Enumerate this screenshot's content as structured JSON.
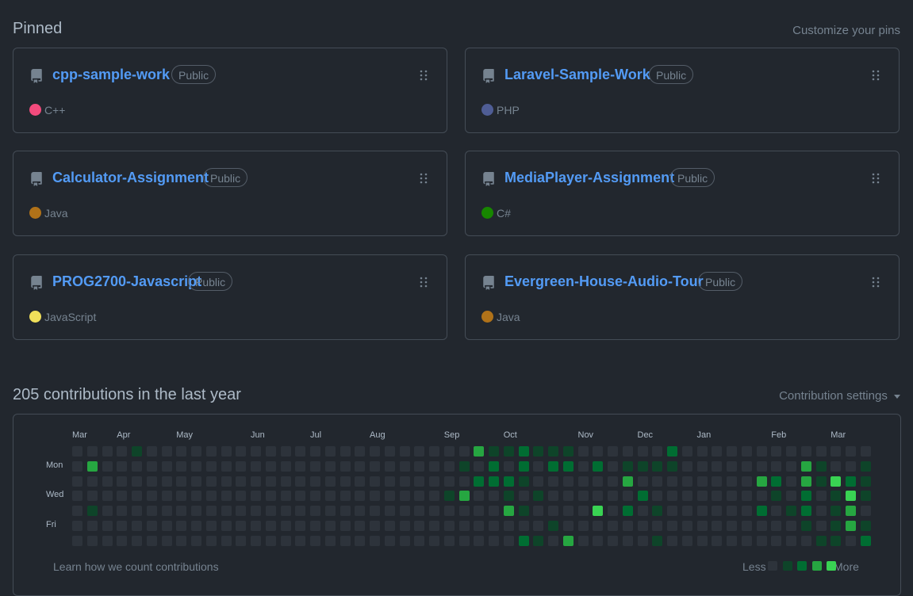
{
  "pinned": {
    "title": "Pinned",
    "customize_label": "Customize your pins",
    "repos": [
      {
        "name": "cpp-sample-work",
        "visibility": "Public",
        "language": "C++",
        "lang_color": "#f34b7d"
      },
      {
        "name": "Laravel-Sample-Work",
        "visibility": "Public",
        "language": "PHP",
        "lang_color": "#4f5d95"
      },
      {
        "name": "Calculator-Assignment",
        "visibility": "Public",
        "language": "Java",
        "lang_color": "#b07219"
      },
      {
        "name": "MediaPlayer-Assignment",
        "visibility": "Public",
        "language": "C#",
        "lang_color": "#178600"
      },
      {
        "name": "PROG2700-Javascript",
        "visibility": "Public",
        "language": "JavaScript",
        "lang_color": "#f1e05a"
      },
      {
        "name": "Evergreen-House-Audio-Tour",
        "visibility": "Public",
        "language": "Java",
        "lang_color": "#b07219"
      }
    ]
  },
  "contributions": {
    "title": "205 contributions in the last year",
    "settings_label": "Contribution settings",
    "months": [
      {
        "label": "Mar",
        "week": 0
      },
      {
        "label": "Apr",
        "week": 3
      },
      {
        "label": "May",
        "week": 7
      },
      {
        "label": "Jun",
        "week": 12
      },
      {
        "label": "Jul",
        "week": 16
      },
      {
        "label": "Aug",
        "week": 20
      },
      {
        "label": "Sep",
        "week": 25
      },
      {
        "label": "Oct",
        "week": 29
      },
      {
        "label": "Nov",
        "week": 34
      },
      {
        "label": "Dec",
        "week": 38
      },
      {
        "label": "Jan",
        "week": 42
      },
      {
        "label": "Feb",
        "week": 47
      },
      {
        "label": "Mar",
        "week": 51
      }
    ],
    "days": [
      {
        "label": "Mon",
        "row": 1
      },
      {
        "label": "Wed",
        "row": 3
      },
      {
        "label": "Fri",
        "row": 5
      }
    ],
    "level_colors": [
      "#2d333b",
      "#0e4429",
      "#006d32",
      "#26a641",
      "#39d353"
    ],
    "cells": [
      [
        0,
        0,
        0,
        0,
        0,
        0,
        0
      ],
      [
        0,
        3,
        0,
        0,
        1,
        0,
        0
      ],
      [
        0,
        0,
        0,
        0,
        0,
        0,
        0
      ],
      [
        0,
        0,
        0,
        0,
        0,
        0,
        0
      ],
      [
        1,
        0,
        0,
        0,
        0,
        0,
        0
      ],
      [
        0,
        0,
        0,
        0,
        0,
        0,
        0
      ],
      [
        0,
        0,
        0,
        0,
        0,
        0,
        0
      ],
      [
        0,
        0,
        0,
        0,
        0,
        0,
        0
      ],
      [
        0,
        0,
        0,
        0,
        0,
        0,
        0
      ],
      [
        0,
        0,
        0,
        0,
        0,
        0,
        0
      ],
      [
        0,
        0,
        0,
        0,
        0,
        0,
        0
      ],
      [
        0,
        0,
        0,
        0,
        0,
        0,
        0
      ],
      [
        0,
        0,
        0,
        0,
        0,
        0,
        0
      ],
      [
        0,
        0,
        0,
        0,
        0,
        0,
        0
      ],
      [
        0,
        0,
        0,
        0,
        0,
        0,
        0
      ],
      [
        0,
        0,
        0,
        0,
        0,
        0,
        0
      ],
      [
        0,
        0,
        0,
        0,
        0,
        0,
        0
      ],
      [
        0,
        0,
        0,
        0,
        0,
        0,
        0
      ],
      [
        0,
        0,
        0,
        0,
        0,
        0,
        0
      ],
      [
        0,
        0,
        0,
        0,
        0,
        0,
        0
      ],
      [
        0,
        0,
        0,
        0,
        0,
        0,
        0
      ],
      [
        0,
        0,
        0,
        0,
        0,
        0,
        0
      ],
      [
        0,
        0,
        0,
        0,
        0,
        0,
        0
      ],
      [
        0,
        0,
        0,
        0,
        0,
        0,
        0
      ],
      [
        0,
        0,
        0,
        0,
        0,
        0,
        0
      ],
      [
        0,
        0,
        0,
        1,
        0,
        0,
        0
      ],
      [
        0,
        1,
        0,
        3,
        0,
        0,
        0
      ],
      [
        3,
        0,
        2,
        0,
        0,
        0,
        0
      ],
      [
        1,
        2,
        2,
        0,
        0,
        0,
        0
      ],
      [
        1,
        0,
        2,
        1,
        3,
        0,
        0
      ],
      [
        2,
        2,
        1,
        0,
        1,
        0,
        2
      ],
      [
        1,
        0,
        0,
        1,
        0,
        0,
        1
      ],
      [
        1,
        2,
        0,
        0,
        0,
        1,
        0
      ],
      [
        1,
        2,
        0,
        0,
        0,
        0,
        3
      ],
      [
        0,
        0,
        0,
        0,
        0,
        0,
        0
      ],
      [
        0,
        2,
        0,
        0,
        4,
        0,
        0
      ],
      [
        0,
        0,
        0,
        0,
        0,
        0,
        0
      ],
      [
        0,
        1,
        3,
        0,
        2,
        0,
        0
      ],
      [
        0,
        1,
        0,
        2,
        0,
        0,
        0
      ],
      [
        0,
        1,
        0,
        0,
        1,
        0,
        1
      ],
      [
        2,
        1,
        0,
        0,
        0,
        0,
        0
      ],
      [
        0,
        0,
        0,
        0,
        0,
        0,
        0
      ],
      [
        0,
        0,
        0,
        0,
        0,
        0,
        0
      ],
      [
        0,
        0,
        0,
        0,
        0,
        0,
        0
      ],
      [
        0,
        0,
        0,
        0,
        0,
        0,
        0
      ],
      [
        0,
        0,
        0,
        0,
        0,
        0,
        0
      ],
      [
        0,
        0,
        3,
        0,
        2,
        0,
        0
      ],
      [
        0,
        0,
        2,
        1,
        0,
        0,
        0
      ],
      [
        0,
        0,
        0,
        0,
        1,
        0,
        0
      ],
      [
        0,
        3,
        3,
        2,
        2,
        1,
        0
      ],
      [
        0,
        1,
        1,
        0,
        0,
        0,
        1
      ],
      [
        0,
        0,
        4,
        1,
        1,
        1,
        1
      ],
      [
        0,
        0,
        2,
        4,
        3,
        3,
        0
      ],
      [
        0,
        1,
        1,
        1,
        0,
        1,
        2
      ]
    ],
    "footer_link": "Learn how we count contributions",
    "legend_less": "Less",
    "legend_more": "More"
  }
}
